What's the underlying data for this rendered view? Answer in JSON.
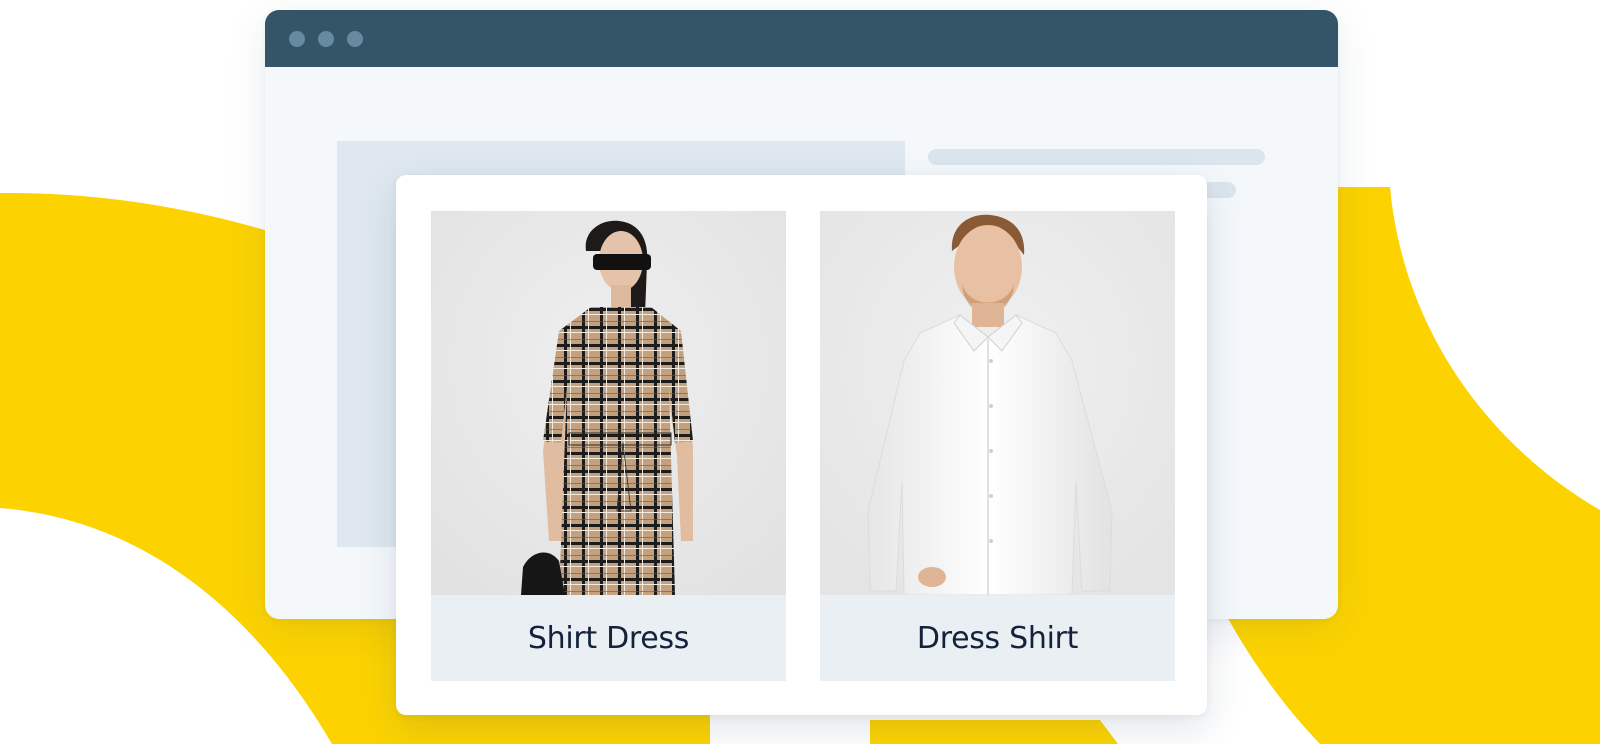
{
  "colors": {
    "accent_yellow": "#fcd300",
    "titlebar": "#345568",
    "window_dot": "#678aa1",
    "window_body": "#f4f8fb",
    "caption_bg": "#eaeff3",
    "caption_text": "#14223b"
  },
  "products": [
    {
      "label": "Shirt Dress",
      "image": "woman-in-plaid-shirt-dress-photo"
    },
    {
      "label": "Dress Shirt",
      "image": "man-in-white-dress-shirt-photo"
    }
  ]
}
